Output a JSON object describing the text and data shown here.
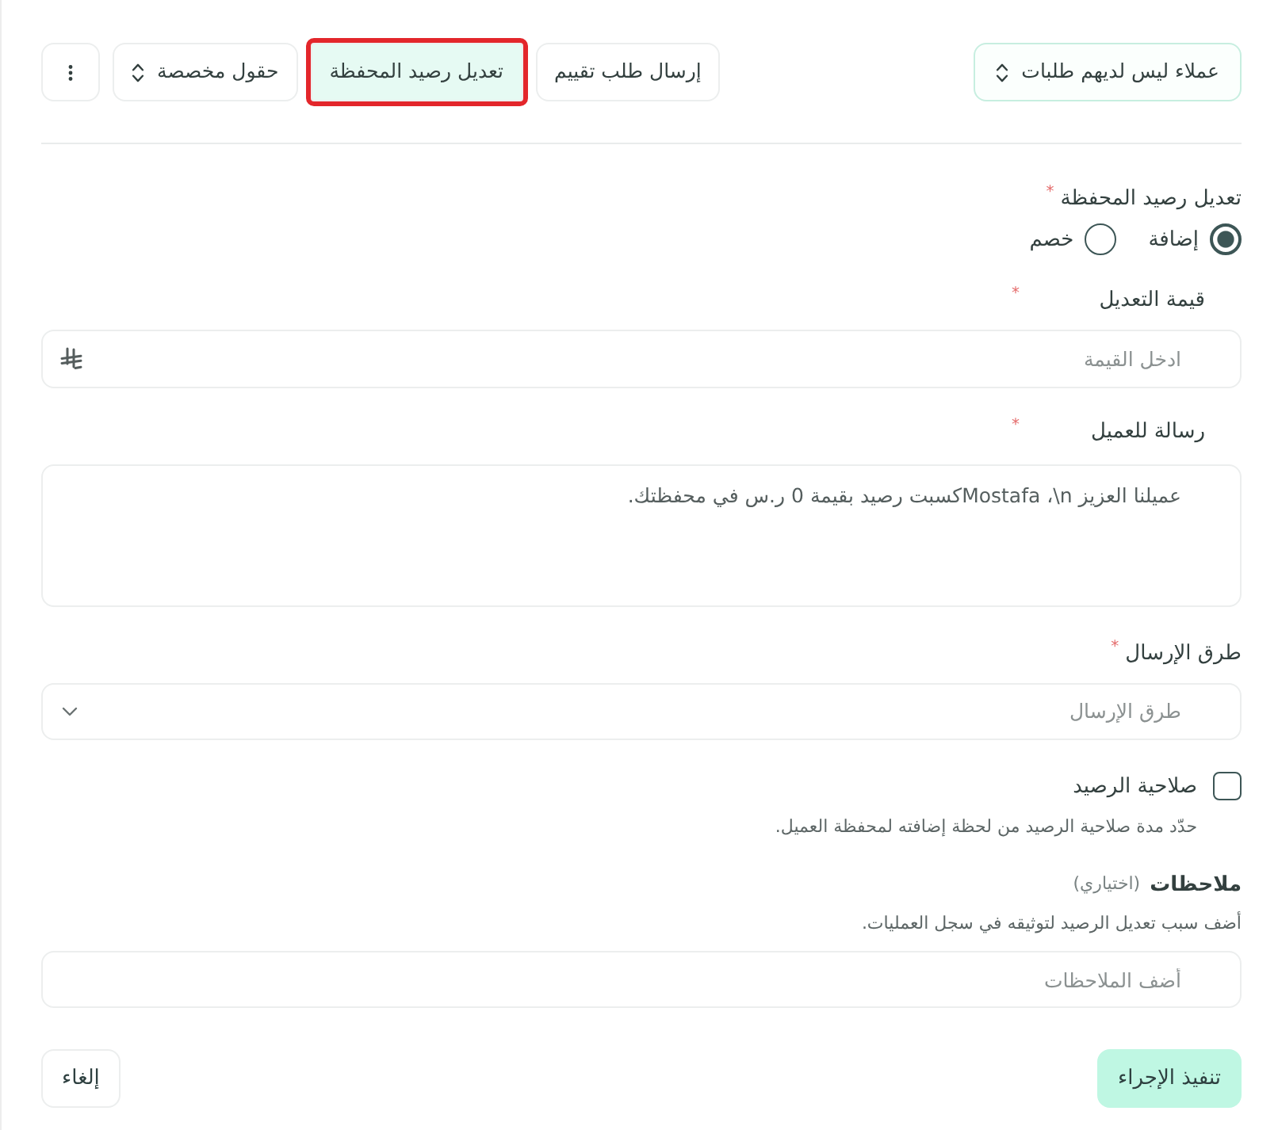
{
  "toolbar": {
    "filter_button": {
      "label": "عملاء ليس لديهم طلبات"
    },
    "actions": [
      {
        "kind": "plain",
        "label": "إرسال طلب تقييم",
        "selected": false,
        "highlighted": false
      },
      {
        "kind": "plain",
        "label": "تعديل رصيد المحفظة",
        "selected": true,
        "highlighted": true
      },
      {
        "kind": "dropdown",
        "label": "حقول مخصصة",
        "selected": false,
        "highlighted": false
      },
      {
        "kind": "more",
        "selected": false,
        "highlighted": false
      }
    ]
  },
  "form": {
    "fields": [
      {
        "kind": "radio",
        "label": "تعديل رصيد المحفظة",
        "required_mark": "*",
        "options": [
          {
            "label": "إضافة",
            "selected": true
          },
          {
            "label": "خصم",
            "selected": false
          }
        ]
      },
      {
        "kind": "amount",
        "label": "قيمة التعديل",
        "required_mark": "*",
        "placeholder": "ادخل القيمة"
      },
      {
        "kind": "textarea",
        "label": "رسالة للعميل",
        "required_mark": "*",
        "value": "عميلنا العزيز Mostafa ،\\nكسبت رصيد بقيمة 0 ر.س في محفظتك."
      },
      {
        "kind": "select",
        "label": "طرق الإرسال",
        "required_mark": "*",
        "placeholder": "طرق الإرسال"
      },
      {
        "kind": "checkbox",
        "label": "صلاحية الرصيد",
        "checked": false,
        "hint": "حدّد مدة صلاحية الرصيد من لحظة إضافته لمحفظة العميل."
      },
      {
        "kind": "text",
        "label": "ملاحظات",
        "label_note": "(اختياري)",
        "hint": "أضف سبب تعديل الرصيد لتوثيقه في سجل العمليات.",
        "placeholder": "أضف الملاحظات"
      }
    ]
  },
  "buttons": [
    {
      "kind": "primary",
      "label": "تنفيذ الإجراء"
    },
    {
      "kind": "secondary",
      "label": "إلغاء"
    }
  ]
}
